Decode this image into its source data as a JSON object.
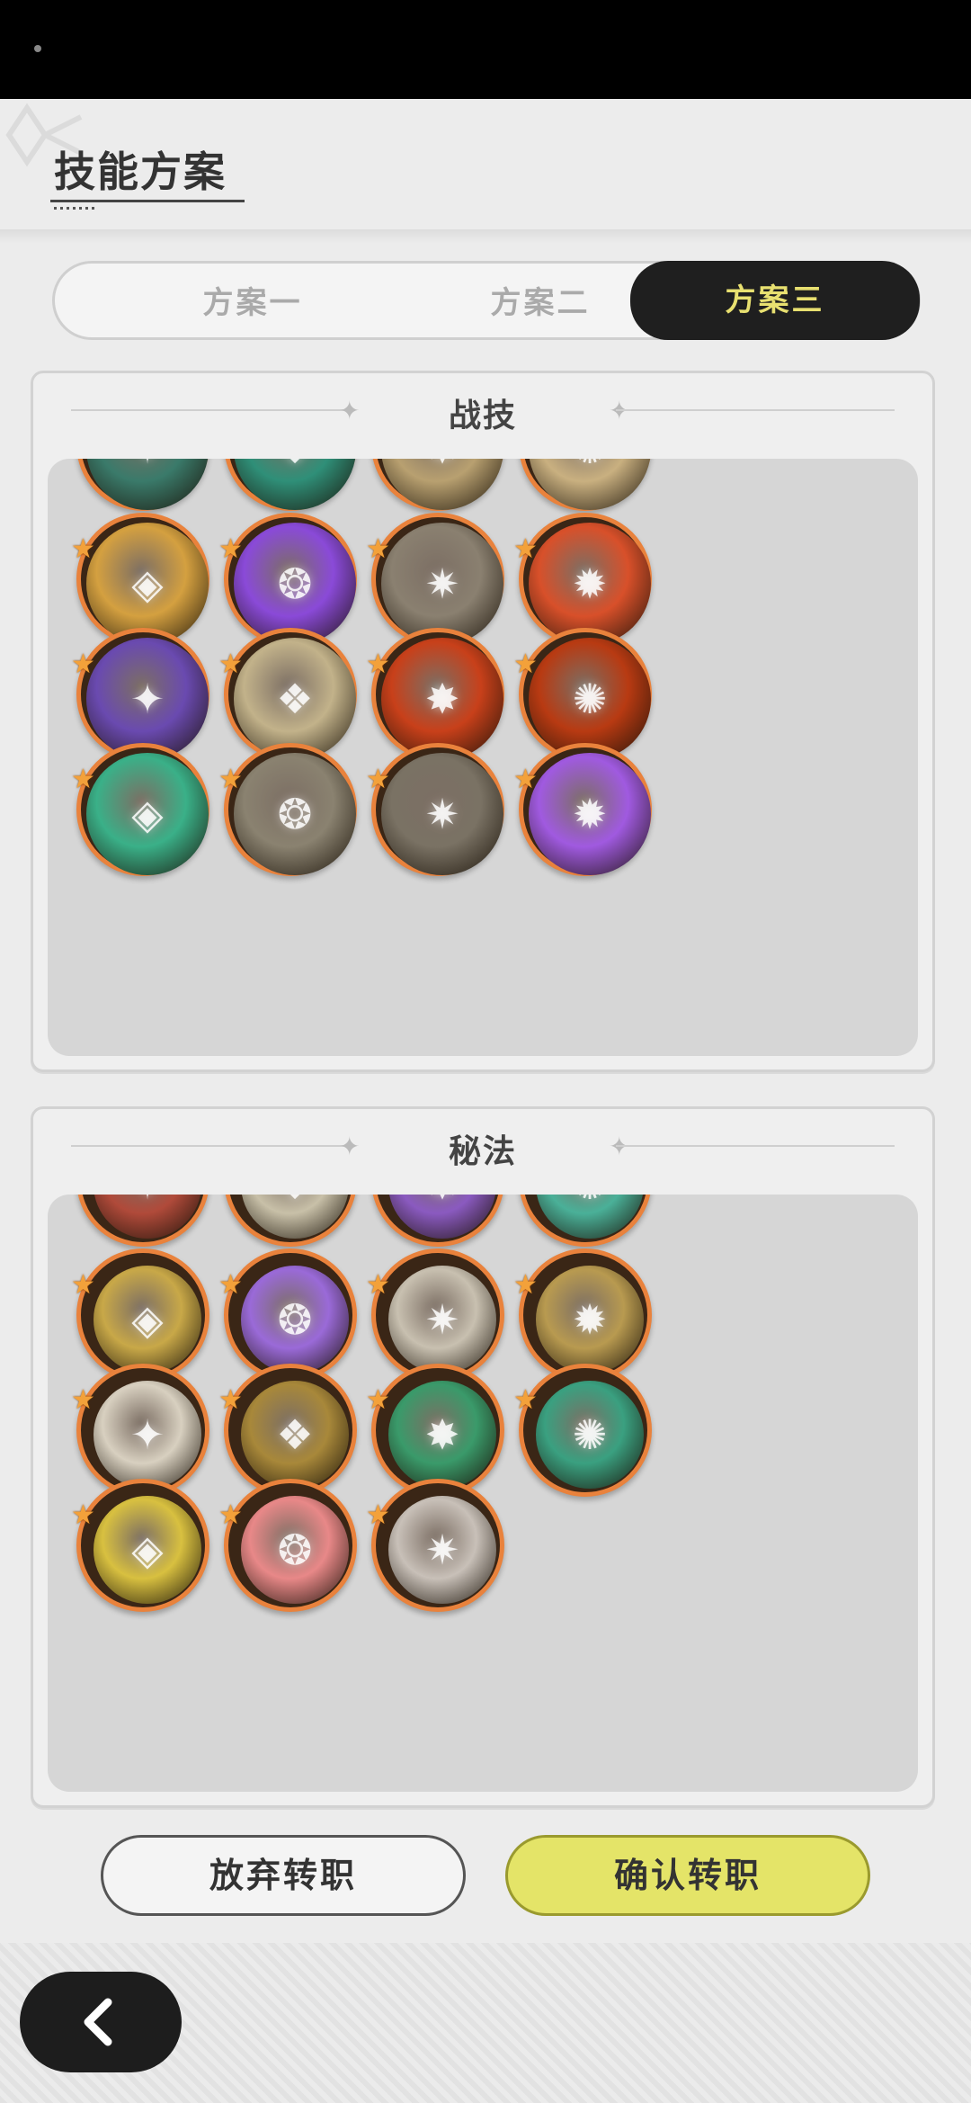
{
  "page": {
    "title": "技能方案"
  },
  "tabs": [
    {
      "label": "方案一",
      "active": false
    },
    {
      "label": "方案二",
      "active": false
    },
    {
      "label": "方案三",
      "active": true
    }
  ],
  "sections": {
    "combat": {
      "title": "战技",
      "icons": [
        {
          "name": "teal-swirl-skill",
          "color": "#3a7a6a"
        },
        {
          "name": "teal-rune-skill",
          "color": "#2f8f78"
        },
        {
          "name": "golden-blade-skill",
          "color": "#b8a070"
        },
        {
          "name": "pale-gold-skill",
          "color": "#c9b080"
        },
        {
          "name": "golden-slash-skill",
          "color": "#d4a040"
        },
        {
          "name": "purple-heart-skill",
          "color": "#8a4ad8"
        },
        {
          "name": "stone-spikes-skill",
          "color": "#8a8070"
        },
        {
          "name": "fire-crest-skill",
          "color": "#d8502a"
        },
        {
          "name": "purple-shadow-skill",
          "color": "#6a4ab0"
        },
        {
          "name": "gold-kick-skill",
          "color": "#c2b28a"
        },
        {
          "name": "flame-arc-skill",
          "color": "#c8401a"
        },
        {
          "name": "fire-burst-skill",
          "color": "#b83a12"
        },
        {
          "name": "green-arrows-skill",
          "color": "#3ab088"
        },
        {
          "name": "wind-swirl-skill",
          "color": "#8a8270"
        },
        {
          "name": "whirl-skill",
          "color": "#7a7264"
        },
        {
          "name": "purple-orb-skill",
          "color": "#a05ae0"
        }
      ]
    },
    "secret": {
      "title": "秘法",
      "icons": [
        {
          "name": "red-sigil-art",
          "color": "#b04a3a"
        },
        {
          "name": "pale-sigil-art",
          "color": "#c8c0a8"
        },
        {
          "name": "violet-sigil-art",
          "color": "#8a5ac0"
        },
        {
          "name": "teal-sigil-art",
          "color": "#4ab098"
        },
        {
          "name": "eye-art",
          "color": "#c8a848"
        },
        {
          "name": "arcane-orb-art",
          "color": "#9a6ad8"
        },
        {
          "name": "crystal-art",
          "color": "#c8c0b0"
        },
        {
          "name": "golden-armor-art",
          "color": "#b89a50"
        },
        {
          "name": "leaf-art",
          "color": "#d8d0c0"
        },
        {
          "name": "shield-armor-art",
          "color": "#a8883a"
        },
        {
          "name": "heart-heal-art",
          "color": "#3a9a6a"
        },
        {
          "name": "healing-circle-art",
          "color": "#3aa080"
        },
        {
          "name": "gold-bell-art",
          "color": "#d8c040"
        },
        {
          "name": "sword-heal-art",
          "color": "#e88888"
        },
        {
          "name": "sword-art",
          "color": "#c8c0b8"
        }
      ]
    }
  },
  "buttons": {
    "cancel": "放弃转职",
    "confirm": "确认转职"
  }
}
